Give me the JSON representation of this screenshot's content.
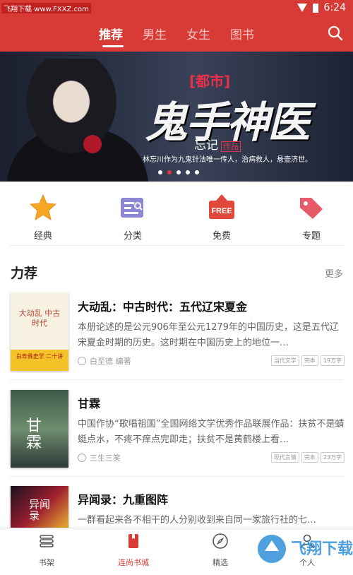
{
  "status": {
    "watermark": "飞翔下载 www.FXXZ.com",
    "time": "6:24"
  },
  "header": {
    "tabs": [
      "推荐",
      "男生",
      "女生",
      "图书"
    ]
  },
  "banner": {
    "tag": "[都市]",
    "title": "鬼手神医",
    "author": "忘记",
    "author_suffix": "作品",
    "desc": "林忘川作为九鬼针法唯一传人，治病救人，悬壶济世。"
  },
  "categories": [
    {
      "label": "经典",
      "icon": "star-icon"
    },
    {
      "label": "分类",
      "icon": "list-search-icon"
    },
    {
      "label": "免费",
      "icon": "free-tag-icon"
    },
    {
      "label": "专题",
      "icon": "label-tag-icon"
    }
  ],
  "section": {
    "title": "力荐",
    "more": "更多"
  },
  "books": [
    {
      "title": "大动乱：中古时代：五代辽宋夏金",
      "desc": "本册论述的是公元906年至公元1279年的中国历史，这是五代辽宋夏金时期的历史。这时期在中国历史上的地位一…",
      "author": "白至德 编著",
      "tags": [
        "当代文学",
        "完本",
        "19万字"
      ],
      "cover_title": "大动乱 中古时代",
      "cover_sub": "白寿彝史学 二十讲"
    },
    {
      "title": "甘霖",
      "desc": "中国作协“歌唱祖国”全国网络文学优秀作品联展作品：扶贫不是蜻蜓点水，不疼不痒点完即走；扶贫不是黄鹤楼上看…",
      "author": "三生三笑",
      "tags": [
        "现代言情",
        "完本",
        "23万字"
      ],
      "cover_title": "甘霖"
    },
    {
      "title": "异闻录：九重图阵",
      "desc": "一群看起来各不相干的人分别收到来自同一家旅行社的七…",
      "cover_title": "异闻录"
    }
  ],
  "bottom_nav": [
    "书架",
    "连尚书城",
    "精选",
    "个人"
  ],
  "colors": {
    "brand": "#d83a35"
  }
}
